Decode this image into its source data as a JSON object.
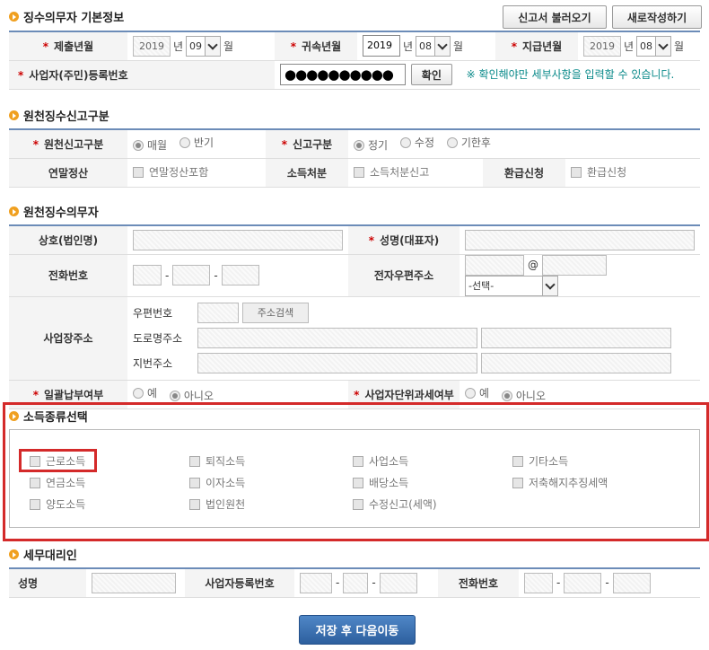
{
  "sections": {
    "basic_info": "징수의무자 기본정보",
    "report_type": "원천징수신고구분",
    "withholder": "원천징수의무자",
    "income_type": "소득종류선택",
    "agent": "세무대리인"
  },
  "header_buttons": {
    "load": "신고서 불러오기",
    "new": "새로작성하기"
  },
  "basic": {
    "submit_ym_label": "제출년월",
    "submit_year": "2019",
    "submit_month": "09",
    "belong_ym_label": "귀속년월",
    "belong_year": "2019",
    "belong_month": "08",
    "pay_ym_label": "지급년월",
    "pay_year": "2019",
    "pay_month": "08",
    "year_unit": "년",
    "month_unit": "월",
    "regno_label": "사업자(주민)등록번호",
    "regno_value": "●●●●●●●●●●",
    "confirm": "확인",
    "notice": "※ 확인해야만 세부사항을 입력할 수 있습니다."
  },
  "report": {
    "orig_label": "원천신고구분",
    "orig_monthly": "매월",
    "orig_half": "반기",
    "type_label": "신고구분",
    "type_regular": "정기",
    "type_amend": "수정",
    "type_late": "기한후",
    "yearend_label": "연말정산",
    "yearend_chk": "연말정산포함",
    "disposal_label": "소득처분",
    "disposal_chk": "소득처분신고",
    "refund_label": "환급신청",
    "refund_chk": "환급신청"
  },
  "withholder": {
    "company_label": "상호(법인명)",
    "name_label": "성명(대표자)",
    "phone_label": "전화번호",
    "email_label": "전자우편주소",
    "email_select": "-선택-",
    "at": "@",
    "address_label": "사업장주소",
    "zip_label": "우편번호",
    "zip_search": "주소검색",
    "road_label": "도로명주소",
    "lot_label": "지번주소",
    "lump_label": "일괄납부여부",
    "unit_label": "사업자단위과세여부",
    "yes": "예",
    "no": "아니오"
  },
  "income_types": [
    "근로소득",
    "퇴직소득",
    "사업소득",
    "기타소득",
    "연금소득",
    "이자소득",
    "배당소득",
    "저축해지추징세액",
    "양도소득",
    "법인원천",
    "수정신고(세액)"
  ],
  "agent": {
    "name_label": "성명",
    "regno_label": "사업자등록번호",
    "phone_label": "전화번호"
  },
  "submit_button": "저장 후 다음이동"
}
